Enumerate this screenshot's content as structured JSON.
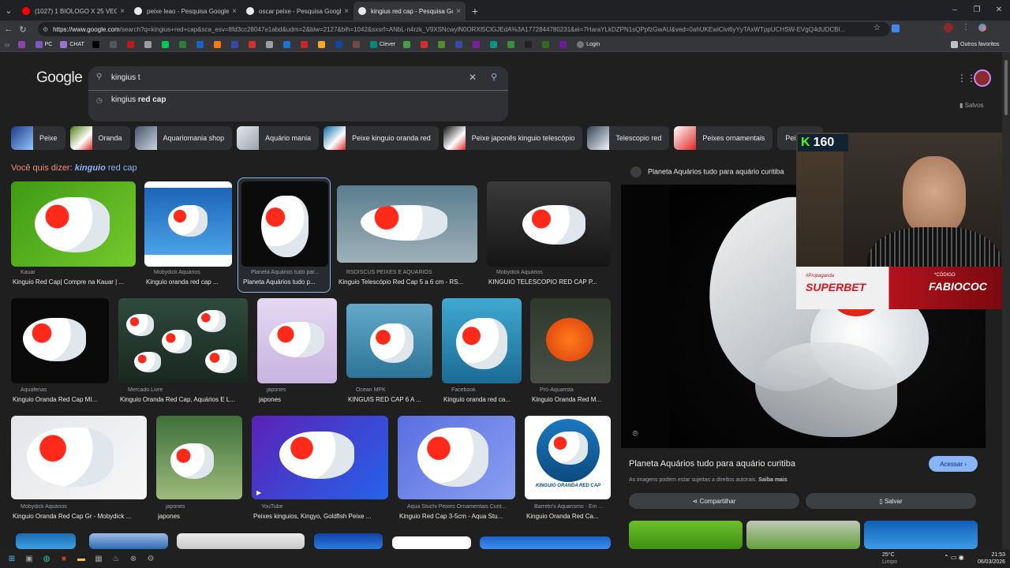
{
  "tabs": [
    {
      "title": "(1027) 1 BIÓLOGO X 25 VEGANOS",
      "color": "#ff0000",
      "active": false
    },
    {
      "title": "peixe leao - Pesquisa Google",
      "color": "#e8eaed",
      "active": false
    },
    {
      "title": "oscar peixe - Pesquisa Google",
      "color": "#e8eaed",
      "active": false
    },
    {
      "title": "kingius red cap - Pesquisa Google",
      "color": "#e8eaed",
      "active": true
    }
  ],
  "tab_close": "×",
  "new_tab": "+",
  "window_controls": {
    "minimize": "–",
    "maximize": "❐",
    "close": "✕"
  },
  "url": {
    "host": "https://www.google.com",
    "rest": "/search?q=kingius+red+cap&sca_esv=8fd3cc28047e1abd&udm=2&biw=2127&bih=1042&sxsrf=ANbL-n4rzk_V9XSNcwylN0ORXI5ClGJEdA%3A1772844780231&ei=7HaraYLkDZPN1sQPpfzGwAU&ved=0ahUKEwiCivi6yYyTAxWTppUCHSW-EVgQ4dUDCBI..."
  },
  "bookmarks": [
    {
      "label": "",
      "color": "#8e44ad"
    },
    {
      "label": "PC",
      "color": "#7e57c2"
    },
    {
      "label": "CHAT",
      "color": "#9575cd"
    },
    {
      "label": "",
      "color": "#000000"
    },
    {
      "label": "",
      "color": "#555555"
    },
    {
      "label": "",
      "color": "#b71c1c"
    },
    {
      "label": "",
      "color": "#9e9e9e"
    },
    {
      "label": "",
      "color": "#00c853"
    },
    {
      "label": "",
      "color": "#2e7d32"
    },
    {
      "label": "",
      "color": "#1565c0"
    },
    {
      "label": "",
      "color": "#f57c00"
    },
    {
      "label": "Clever",
      "color": "#00897b"
    },
    {
      "label": "",
      "color": "#43a047"
    },
    {
      "label": "",
      "color": "#d32f2f"
    },
    {
      "label": "",
      "color": "#558b2f"
    },
    {
      "label": "",
      "color": "#3949ab"
    },
    {
      "label": "",
      "color": "#7b1fa2"
    },
    {
      "label": "",
      "color": "#009688"
    },
    {
      "label": "",
      "color": "#388e3c"
    },
    {
      "label": "Login",
      "color": "#757575"
    }
  ],
  "other_bookmarks": "Outros favoritos",
  "google": {
    "logo": "Google",
    "query": "kingius t",
    "suggestion_plain": "kingius ",
    "suggestion_bold": "red cap",
    "saved": "Salvos"
  },
  "chips": [
    "Peixe",
    "Oranda",
    "Aquariomania shop",
    "Aquário mania",
    "Peixe kinguio oranda red",
    "Peixe japonês kinguio telescópio",
    "Telescopio red",
    "Peixes ornamentais",
    "Peixe red"
  ],
  "did_you_mean": {
    "prefix": "Você quis dizer: ",
    "em": "kinguio",
    "rest": " red cap"
  },
  "results": [
    {
      "source": "Kauar",
      "caption": "Kinguio Red Cap| Compre na Kauar | ..."
    },
    {
      "source": "Mobydick Aquários",
      "caption": "Kinguio oranda red cap ..."
    },
    {
      "source": "Planeta Aquários tudo par...",
      "caption": "Planeta Aquários tudo p..."
    },
    {
      "source": "RSDISCUS PEIXES E AQUÁRIOS",
      "caption": "Kinguio Telescópio Red Cap 5 a 6 cm - RS..."
    },
    {
      "source": "Mobydick Aquários",
      "caption": "KINGUIO TELESCOPIO RED CAP P..."
    },
    {
      "source": "Aquafenas",
      "caption": "Kinguio Oranda Red Cap MI..."
    },
    {
      "source": "Mercado Livre",
      "caption": "Kinguio Oranda Red Cap, Aquários E L..."
    },
    {
      "source": "japones",
      "caption": "japones"
    },
    {
      "source": "Ocean MPK",
      "caption": "KINGUIS RED CAP 6 A ..."
    },
    {
      "source": "Facebook",
      "caption": "Kinguio oranda red ca..."
    },
    {
      "source": "Pró-Aquarista",
      "caption": "Kinguio Oranda Red M..."
    },
    {
      "source": "Mobydick Aquários",
      "caption": "Kinguio Oranda Red Cap Gr - Mobydick ..."
    },
    {
      "source": "japones",
      "caption": "japones"
    },
    {
      "source": "YouTube",
      "caption": "Peixes kinguios, Kingyo, Goldfish Peixe ..."
    },
    {
      "source": "Aqua Stuchi Peixes Ornamentais Curit...",
      "caption": "Kinguio Red Cap 3-5cm - Aqua Stu..."
    },
    {
      "source": "Barreto's Aquarismo - Em ...",
      "caption": "Kinguio Oranda Red Ca..."
    }
  ],
  "badge_text": "KINGUIO ORANDA RED CAP",
  "panel": {
    "source": "Planeta Aquários tudo para aquário curitiba",
    "title": "Planeta Aquários tudo para aquário curitiba",
    "visit": "Acessar",
    "rights": "As imagens podem estar sujeitas a direitos autorais.",
    "learn_more": "Saiba mais",
    "share": "Compartilhar",
    "save": "Salvar"
  },
  "overlay": {
    "counter": "160",
    "ad_tag": "#Propaganda",
    "ad_brand": "SUPERBET",
    "ad_code_label": "*CÓDIGO",
    "ad_code": "FABIOCOC"
  },
  "taskbar": {
    "temp": "25°C",
    "weather": "Limpo",
    "time": "21:53",
    "date": "06/03/2026"
  }
}
